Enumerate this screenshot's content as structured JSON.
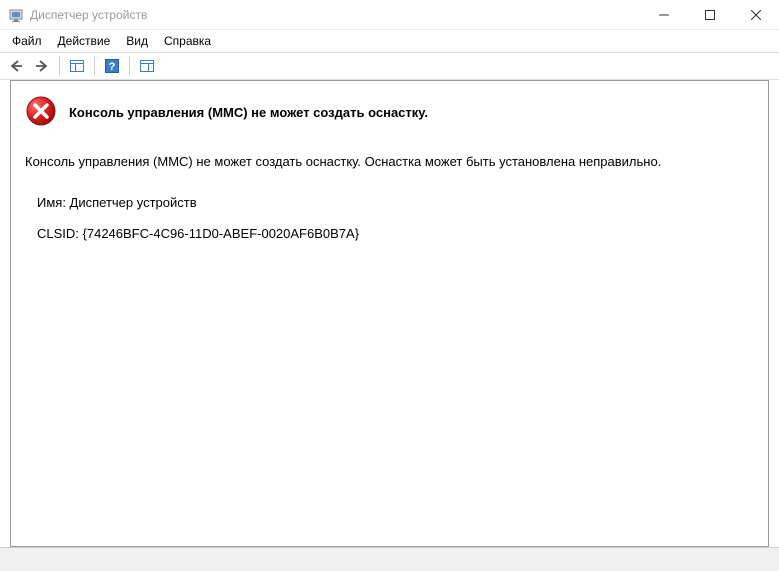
{
  "window": {
    "title": "Диспетчер устройств"
  },
  "menu": {
    "file": "Файл",
    "action": "Действие",
    "view": "Вид",
    "help": "Справка"
  },
  "error": {
    "title": "Консоль управления (MMC) не может создать оснастку.",
    "message": "Консоль управления (MMC) не может создать оснастку. Оснастка может быть установлена неправильно.",
    "name_label": "Имя: Диспетчер устройств",
    "clsid_label": "CLSID: {74246BFC-4C96-11D0-ABEF-0020AF6B0B7A}"
  }
}
